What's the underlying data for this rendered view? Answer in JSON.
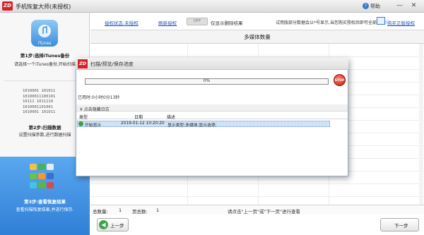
{
  "app": {
    "logo": "ZD",
    "title": "手机恢复大师(未授权)",
    "help": "帮助",
    "window_buttons": [
      "—",
      "✕"
    ]
  },
  "sidebar": {
    "step1": {
      "badge": "iTunes",
      "title": "第1步:选择iTunes备份",
      "desc": "请选择一个iTunes备份,开始扫描"
    },
    "binary_lines": [
      "1010001 101011",
      "10100011100101",
      "10111 1011110",
      "1010001101001",
      "1010001 101011"
    ],
    "step2": {
      "title": "第2步:扫描数据",
      "desc": "设置扫描参数,进行数据扫描"
    },
    "step3": {
      "title": "第3步:查看恢复结果",
      "desc": "查看扫描恢复结果,并进行保存."
    }
  },
  "toolbar": {
    "auth_status": "授权状态:未授权",
    "refresh_auth": "刷新授权",
    "toggle": "OFF",
    "only_deleted": "仅显示删除结果",
    "trial_note": "试用版部分数据会以*号显示,当您购买授权后即可全部显示!",
    "buy": "购买正版授权"
  },
  "table": {
    "header": "多媒体数量"
  },
  "footer": {
    "total_label": "总数量:",
    "total_value": "1",
    "pages_label": "页总数:",
    "pages_value": "1",
    "page_hint": "请点击\"上一页\"或\"下一页\"进行查看",
    "prev": "上一步",
    "next": "下一步"
  },
  "dialog": {
    "logo": "ZD",
    "title": "扫描/预览/保存进度",
    "progress_text": "0%",
    "progress": 0,
    "stop": "STOP",
    "elapsed": "已用时:0小时0分13秒",
    "log_title": "点击隐藏日志",
    "columns": {
      "type": "类型",
      "date": "日期",
      "desc": "描述"
    },
    "rows": [
      {
        "type": "开始显示",
        "date": "2019-01-12 10:20:20",
        "desc": "显示类型:多媒体;显示选项:"
      }
    ]
  },
  "colors": {
    "accent_blue": "#3b8fdc",
    "link": "#2a58b5",
    "stop_red": "#c01d13",
    "step3_bg": "#2f7fd6"
  }
}
